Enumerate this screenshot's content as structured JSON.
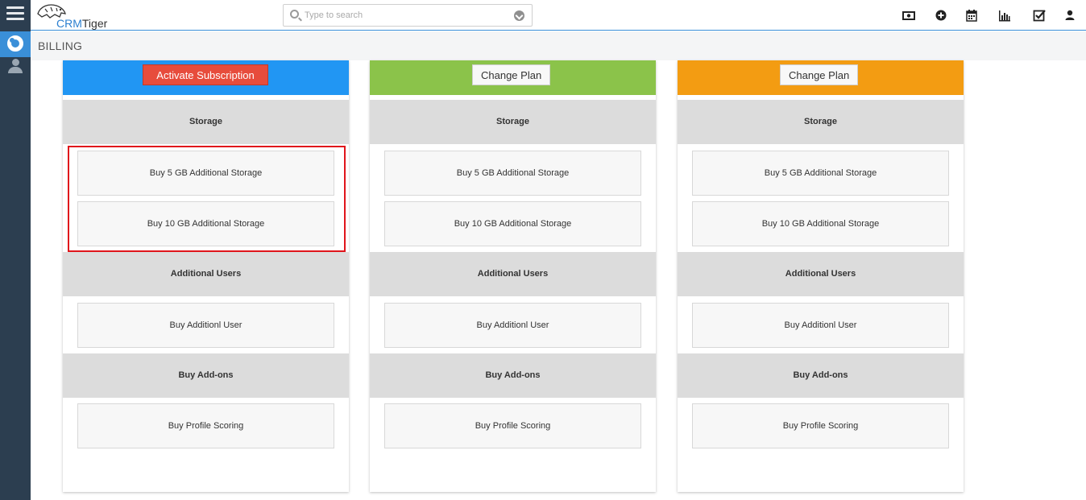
{
  "app": {
    "logo_crm": "CRM",
    "logo_tiger": "Tiger",
    "search_placeholder": "Type to search"
  },
  "toolbar": {
    "icons": [
      "money-icon",
      "add-circle-icon",
      "calendar-icon",
      "bar-chart-icon",
      "checkbox-icon",
      "user-icon"
    ]
  },
  "page": {
    "title": "BILLING"
  },
  "colors": {
    "rail": "#2c3e50",
    "accent": "#3a8fd8",
    "plan1": "#2196f3",
    "plan2": "#8bc34a",
    "plan3": "#f39c12",
    "activate": "#e74c3c",
    "highlight": "#e0151b"
  },
  "plans": [
    {
      "button": "Activate Subscription",
      "sections": {
        "storage": "Storage",
        "storage_items": [
          "Buy 5 GB Additional Storage",
          "Buy 10 GB Additional Storage"
        ],
        "users": "Additional Users",
        "users_items": [
          "Buy Additionl User"
        ],
        "addons": "Buy Add-ons",
        "addons_items": [
          "Buy Profile Scoring"
        ]
      }
    },
    {
      "button": "Change Plan",
      "sections": {
        "storage": "Storage",
        "storage_items": [
          "Buy 5 GB Additional Storage",
          "Buy 10 GB Additional Storage"
        ],
        "users": "Additional Users",
        "users_items": [
          "Buy Additionl User"
        ],
        "addons": "Buy Add-ons",
        "addons_items": [
          "Buy Profile Scoring"
        ]
      }
    },
    {
      "button": "Change Plan",
      "sections": {
        "storage": "Storage",
        "storage_items": [
          "Buy 5 GB Additional Storage",
          "Buy 10 GB Additional Storage"
        ],
        "users": "Additional Users",
        "users_items": [
          "Buy Additionl User"
        ],
        "addons": "Buy Add-ons",
        "addons_items": [
          "Buy Profile Scoring"
        ]
      }
    }
  ]
}
